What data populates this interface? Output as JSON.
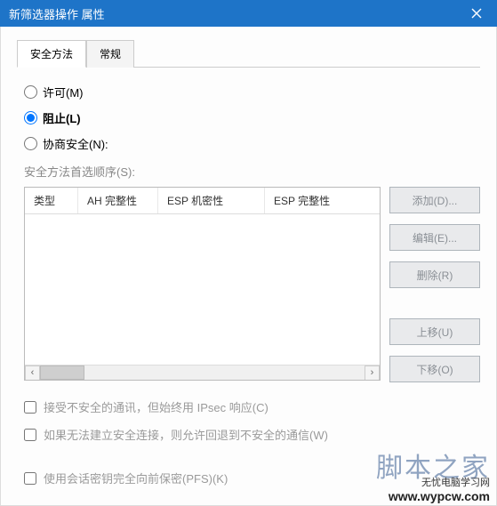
{
  "window": {
    "title": "新筛选器操作 属性"
  },
  "tabs": {
    "security": "安全方法",
    "general": "常规"
  },
  "radios": {
    "permit": "许可(M)",
    "block": "阻止(L)",
    "negotiate": "协商安全(N):"
  },
  "list": {
    "label": "安全方法首选顺序(S):",
    "columns": {
      "type": "类型",
      "ah": "AH 完整性",
      "esp_conf": "ESP 机密性",
      "esp_integ": "ESP 完整性"
    }
  },
  "buttons": {
    "add": "添加(D)...",
    "edit": "编辑(E)...",
    "remove": "删除(R)",
    "up": "上移(U)",
    "down": "下移(O)"
  },
  "checks": {
    "accept_unsecured": "接受不安全的通讯，但始终用 IPsec 响应(C)",
    "fallback_unsecured": "如果无法建立安全连接，则允许回退到不安全的通信(W)",
    "pfs": "使用会话密钥完全向前保密(PFS)(K)"
  },
  "watermarks": {
    "site": "www.wypcw.com",
    "cn_top": "无忧电脑学习网",
    "cn_big": "脚本之家"
  }
}
